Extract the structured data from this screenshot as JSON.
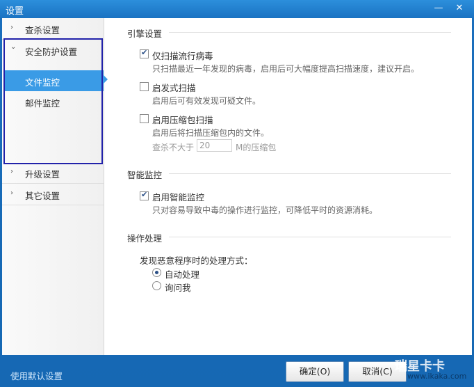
{
  "window": {
    "title": "设置"
  },
  "controls": {
    "minimize": "—",
    "close": "✕"
  },
  "sidebar": {
    "items": [
      {
        "label": "查杀设置",
        "chevron": "›"
      },
      {
        "label": "安全防护设置",
        "chevron": "⌄"
      },
      {
        "label": "升级设置",
        "chevron": "›"
      },
      {
        "label": "其它设置",
        "chevron": "›"
      }
    ],
    "subitems": [
      {
        "label": "文件监控",
        "active": true
      },
      {
        "label": "邮件监控",
        "active": false
      }
    ]
  },
  "engine": {
    "title": "引擎设置",
    "options": [
      {
        "label": "仅扫描流行病毒",
        "checked": true,
        "desc": "只扫描最近一年发现的病毒，启用后可大幅度提高扫描速度，建议开启。"
      },
      {
        "label": "启发式扫描",
        "checked": false,
        "desc": "启用后可有效发现可疑文件。"
      },
      {
        "label": "启用压缩包扫描",
        "checked": false,
        "desc": "启用后将扫描压缩包内的文件。"
      }
    ],
    "size_prefix": "查杀不大于",
    "size_value": "20",
    "size_suffix": "M的压缩包"
  },
  "smart": {
    "title": "智能监控",
    "option": {
      "label": "启用智能监控",
      "checked": true,
      "desc": "只对容易导致中毒的操作进行监控，可降低平时的资源消耗。"
    }
  },
  "action": {
    "title": "操作处理",
    "prompt": "发现恶意程序时的处理方式：",
    "radios": [
      {
        "label": "自动处理",
        "checked": true
      },
      {
        "label": "询问我",
        "checked": false
      }
    ]
  },
  "footer": {
    "defaults_link": "使用默认设置",
    "ok": "确定(O)",
    "cancel": "取消(C)"
  },
  "watermark": {
    "line1": "瑞星卡卡",
    "line2": "www.ikaka.com"
  }
}
